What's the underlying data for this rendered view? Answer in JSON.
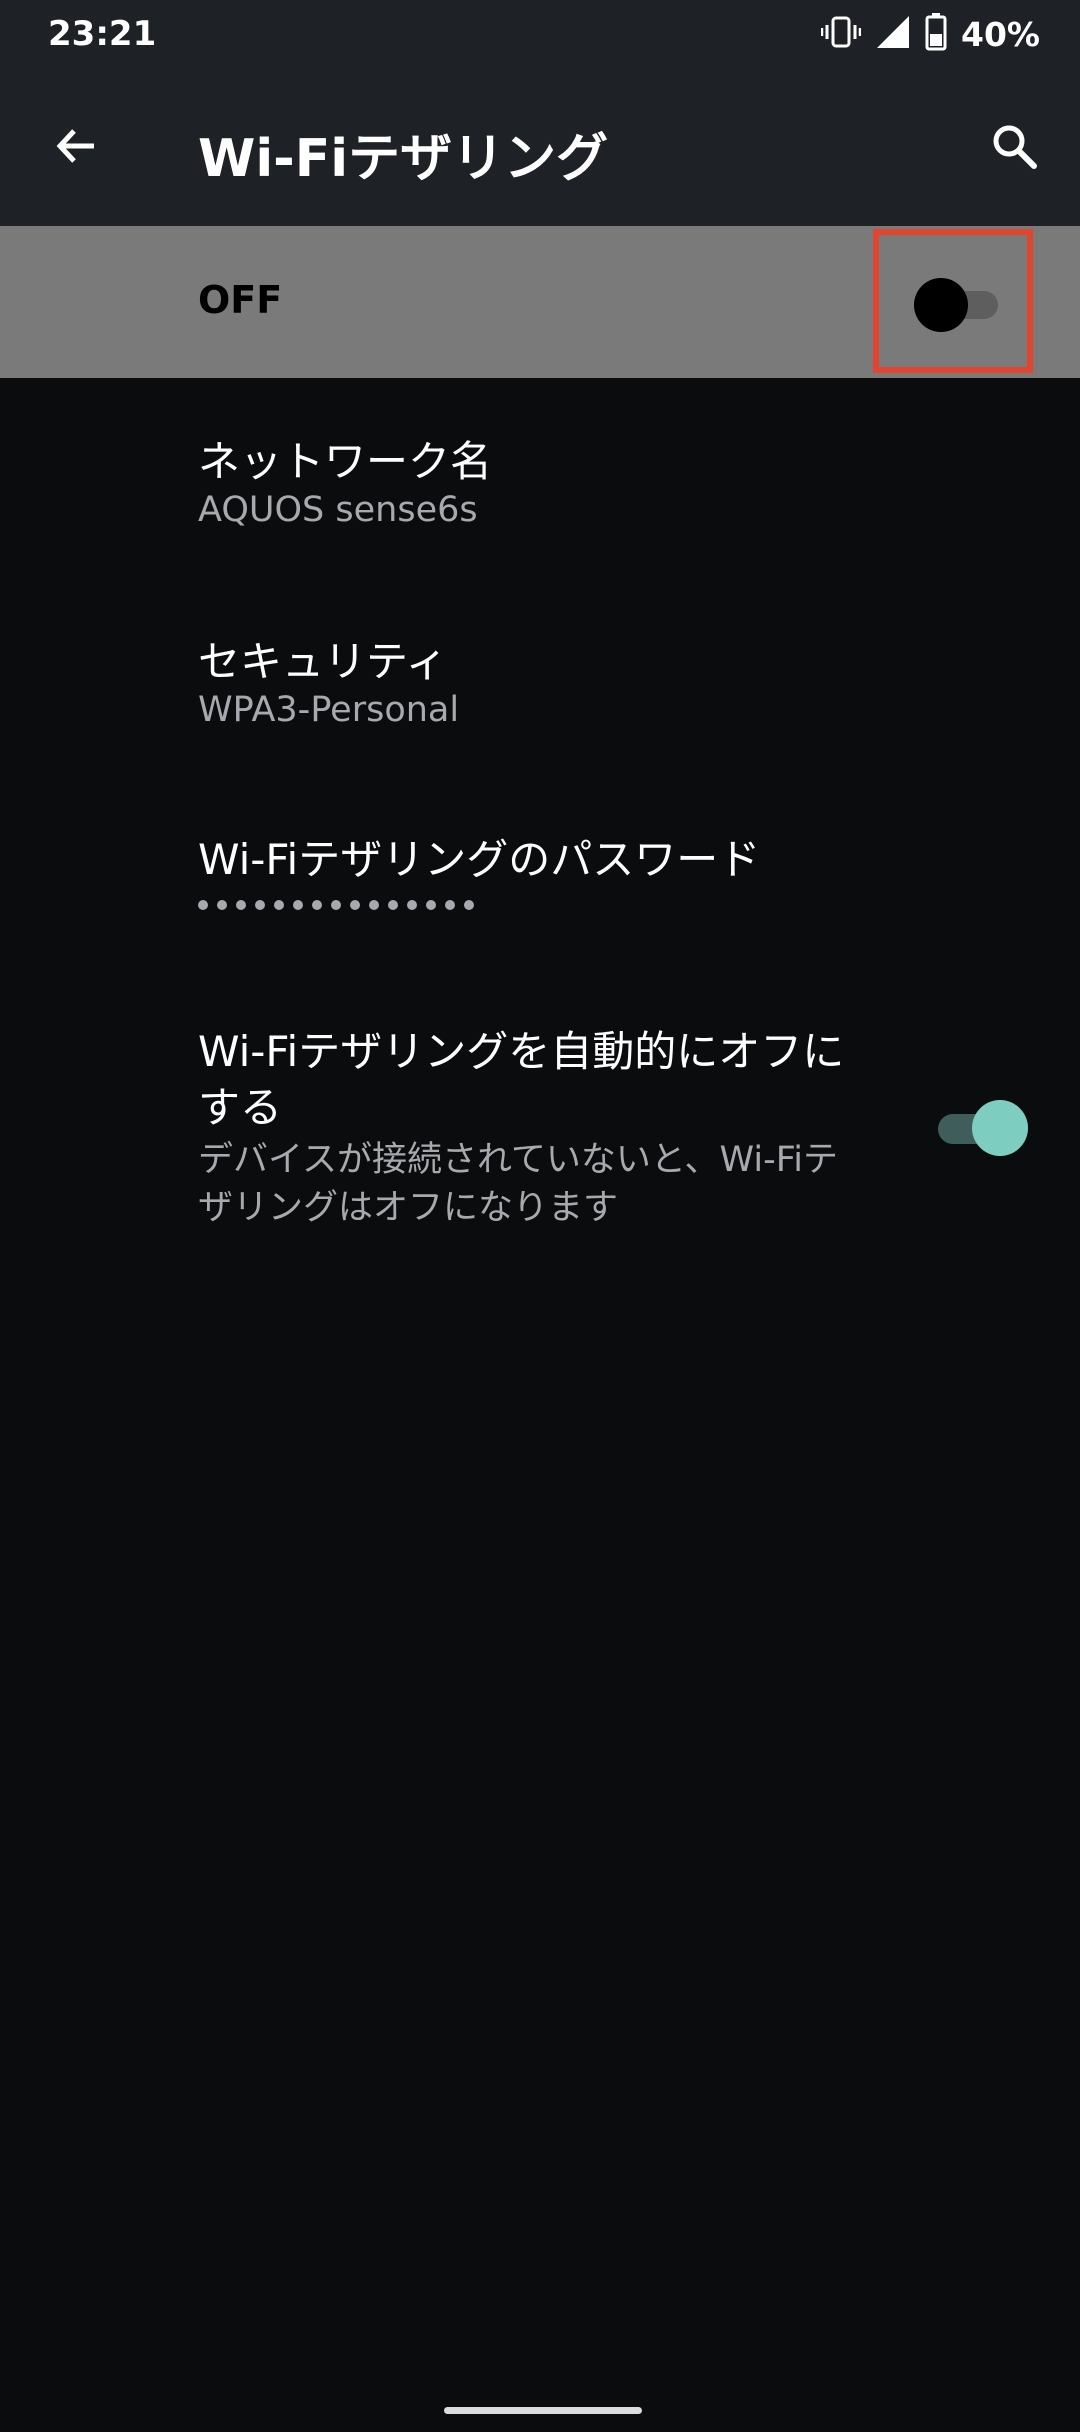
{
  "status_bar": {
    "time": "23:21",
    "battery_percent": "40%",
    "icons": [
      "vibrate-icon",
      "signal-icon",
      "battery-icon"
    ]
  },
  "app_bar": {
    "title": "Wi-Fiテザリング",
    "back_icon": "arrow-left-icon",
    "search_icon": "search-icon"
  },
  "master_switch": {
    "label": "OFF",
    "checked": false,
    "highlight_color": "#e2452f"
  },
  "settings": {
    "network_name": {
      "title": "ネットワーク名",
      "value": "AQUOS sense6s"
    },
    "security": {
      "title": "セキュリティ",
      "value": "WPA3-Personal"
    },
    "password": {
      "title": "Wi-Fiテザリングのパスワード",
      "masked": "•••••••••••••••"
    },
    "auto_off": {
      "title": "Wi-Fiテザリングを自動的にオフにする",
      "summary": "デバイスが接続されていないと、Wi-Fiテザリングはオフになります",
      "checked": true,
      "accent_color": "#7ecdc1"
    }
  }
}
